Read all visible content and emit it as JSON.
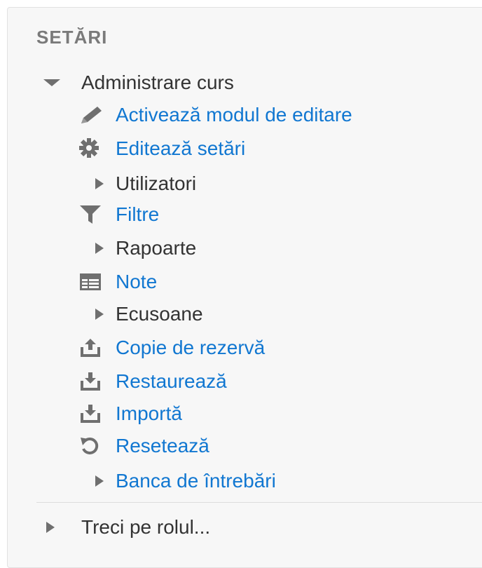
{
  "block": {
    "title": "SETĂRI",
    "root": {
      "label": "Administrare curs",
      "icon": "caret-down-icon"
    },
    "items": [
      {
        "label": "Activează modul de editare",
        "icon": "pencil-icon",
        "type": "link"
      },
      {
        "label": "Editează setări",
        "icon": "gear-icon",
        "type": "link"
      },
      {
        "label": "Utilizatori",
        "icon": "caret-right-icon",
        "type": "branch"
      },
      {
        "label": "Filtre",
        "icon": "filter-icon",
        "type": "link"
      },
      {
        "label": "Rapoarte",
        "icon": "caret-right-icon",
        "type": "branch"
      },
      {
        "label": "Note",
        "icon": "table-icon",
        "type": "link"
      },
      {
        "label": "Ecusoane",
        "icon": "caret-right-icon",
        "type": "branch"
      },
      {
        "label": "Copie de rezervă",
        "icon": "upload-icon",
        "type": "link"
      },
      {
        "label": "Restaurează",
        "icon": "download-icon",
        "type": "link"
      },
      {
        "label": "Importă",
        "icon": "download-icon",
        "type": "link"
      },
      {
        "label": "Resetează",
        "icon": "reset-icon",
        "type": "link"
      },
      {
        "label": "Banca de întrebări",
        "icon": "caret-right-icon",
        "type": "branch-link"
      }
    ],
    "footer": {
      "label": "Treci pe rolul...",
      "icon": "caret-right-icon"
    }
  }
}
